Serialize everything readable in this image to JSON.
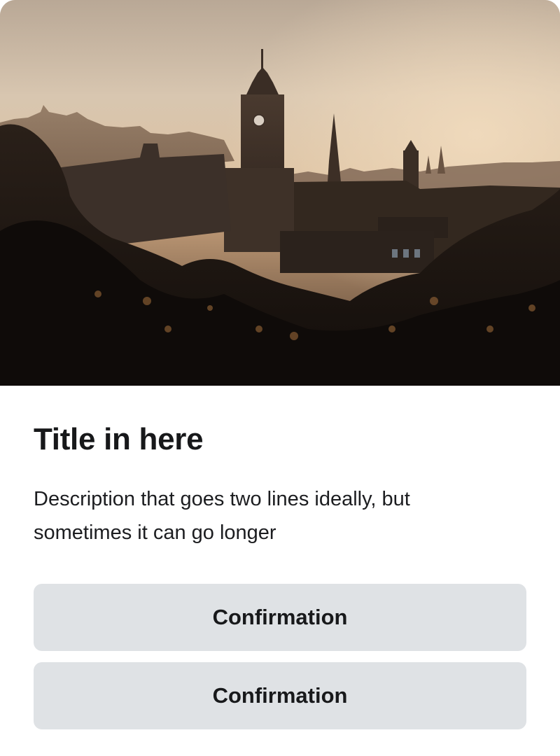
{
  "card": {
    "image_alt": "City skyline with clock tower at sunset",
    "title": "Title in here",
    "description": "Description that goes two lines ideally, but sometimes it can go longer",
    "buttons": [
      {
        "label": "Confirmation"
      },
      {
        "label": "Confirmation"
      }
    ]
  },
  "colors": {
    "button_bg": "#dfe2e5",
    "text": "#17181a",
    "card_bg": "#ffffff"
  }
}
